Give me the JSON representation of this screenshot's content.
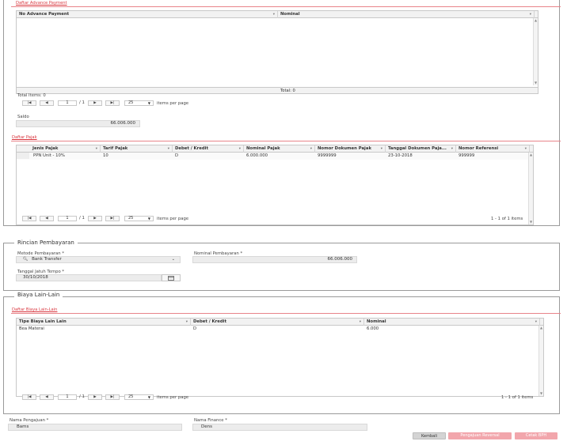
{
  "advance": {
    "title": "Daftar Advance Payment",
    "columns": [
      "No Advance Payment",
      "Nominal"
    ],
    "total_items": "Total Items: 0",
    "total_label": "Total: 0",
    "pager": {
      "first": "|◀",
      "prev": "◀",
      "page": "1",
      "of": "/ 1",
      "next": "▶",
      "last": "▶|",
      "page_size": "25",
      "items_per_page": "items per page"
    }
  },
  "saldo": {
    "label": "Saldo",
    "value": "66.006.000"
  },
  "pajak": {
    "title": "Daftar Pajak",
    "columns": [
      "Jenis Pajak",
      "Tarif Pajak",
      "Debet / Kredit",
      "Nominal Pajak",
      "Nomor Dokumen Pajak",
      "Tanggal Dokumen Paja...",
      "Nomor Referensi"
    ],
    "row": [
      "PPN Unit - 10%",
      "10",
      "D",
      "6.000.000",
      "9999999",
      "23-10-2018",
      "999999"
    ],
    "pager": {
      "first": "|◀",
      "prev": "◀",
      "page": "1",
      "of": "/ 1",
      "next": "▶",
      "last": "▶|",
      "page_size": "25",
      "items_per_page": "items per page",
      "summary": "1 - 1 of 1 items"
    }
  },
  "rincian": {
    "title": "Rincian Pembayaran",
    "metode_label": "Metode Pembayaran *",
    "metode_value": "Bank Transfer",
    "nominal_label": "Nominal Pembayaran *",
    "nominal_value": "66.006.000",
    "tanggal_label": "Tanggal Jatuh Tempo *",
    "tanggal_value": "30/10/2018"
  },
  "biaya": {
    "title": "Biaya Lain-Lain",
    "subtitle": "Daftar Biaya Lain-Lain",
    "columns": [
      "Tipe Biaya Lain Lain",
      "Debet / Kredit",
      "Nominal"
    ],
    "row": [
      "Bea Materai",
      "D",
      "6.000"
    ],
    "pager": {
      "first": "|◀",
      "prev": "◀",
      "page": "1",
      "of": "/ 1",
      "next": "▶",
      "last": "▶|",
      "page_size": "25",
      "items_per_page": "items per page",
      "summary": "1 - 1 of 1 items"
    }
  },
  "footer": {
    "pengajuan_label": "Nama Pengajuan *",
    "pengajuan_value": "Bams",
    "finance_label": "Nama Finance *",
    "finance_value": "Dens",
    "btn_kembali": "Kembali",
    "btn_reversal": "Pengajuan Reversal",
    "btn_cetak": "Cetak BPH"
  },
  "colors": {
    "accent_red": "#d9363e",
    "button_pink": "#f2a6ac",
    "button_gray": "#d4d4d4"
  },
  "icons": {
    "search": "search-icon",
    "calendar": "calendar-icon",
    "column_menu": "column-menu-icon"
  }
}
